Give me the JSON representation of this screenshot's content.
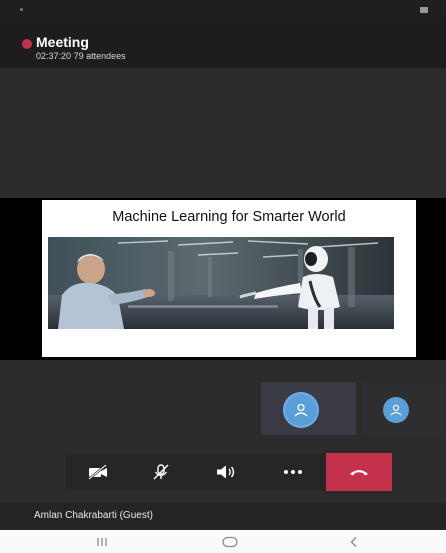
{
  "header": {
    "title": "Meeting",
    "elapsed": "02:37:20",
    "attendees": "79 attendees"
  },
  "slide": {
    "title": "Machine Learning for Smarter World"
  },
  "participant": {
    "name": "Amlan Chakrabarti (Guest)"
  },
  "controls": [
    {
      "name": "video-off",
      "icon": "video-off-icon"
    },
    {
      "name": "mic-off",
      "icon": "mic-off-icon"
    },
    {
      "name": "speaker",
      "icon": "speaker-icon"
    },
    {
      "name": "more",
      "icon": "more-icon"
    },
    {
      "name": "hang-up",
      "icon": "hang-up-icon"
    }
  ],
  "navigation": [
    {
      "name": "recents",
      "icon": "recents-icon"
    },
    {
      "name": "home",
      "icon": "home-icon"
    },
    {
      "name": "back",
      "icon": "back-icon"
    }
  ],
  "colors": {
    "background": "#2c2c2d",
    "header": "#1d1d1e",
    "record": "#c4314b",
    "hangup": "#c4314b",
    "avatar": "#5b9fd8",
    "slide": "#ffffff",
    "share_band": "#000000",
    "nav_bar": "#fafafa"
  }
}
